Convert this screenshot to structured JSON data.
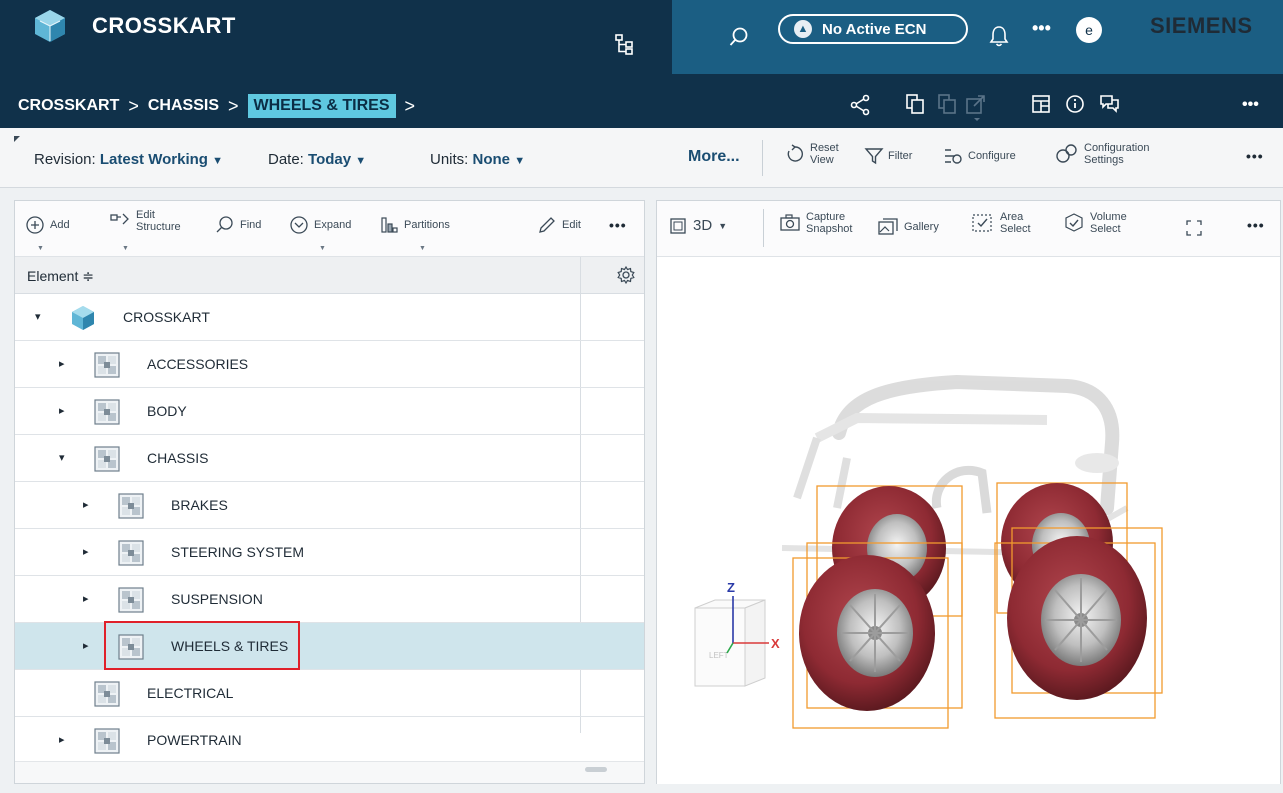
{
  "header": {
    "app_title": "CROSSKART",
    "ecn_label": "No Active ECN",
    "avatar_initial": "e",
    "brand": "SIEMENS",
    "more_glyph": "•••"
  },
  "breadcrumb": {
    "items": [
      "CROSSKART",
      "CHASSIS",
      "WHEELS & TIRES"
    ],
    "separator": ">"
  },
  "filter_bar": {
    "revision_label": "Revision:",
    "revision_value": "Latest Working",
    "date_label": "Date:",
    "date_value": "Today",
    "units_label": "Units:",
    "units_value": "None",
    "more_label": "More...",
    "reset_view_1": "Reset",
    "reset_view_2": "View",
    "filter_label": "Filter",
    "configure_label": "Configure",
    "config_settings_1": "Configuration",
    "config_settings_2": "Settings",
    "more_glyph": "•••"
  },
  "structure_toolbar": {
    "add": "Add",
    "edit_structure_1": "Edit",
    "edit_structure_2": "Structure",
    "find": "Find",
    "expand": "Expand",
    "partitions": "Partitions",
    "edit": "Edit",
    "more_glyph": "•••"
  },
  "structure_table": {
    "column_header": "Element ≑",
    "rows": [
      {
        "label": "CROSSKART",
        "twisty": "▾"
      },
      {
        "label": "ACCESSORIES",
        "twisty": "▸"
      },
      {
        "label": "BODY",
        "twisty": "▸"
      },
      {
        "label": "CHASSIS",
        "twisty": "▾"
      },
      {
        "label": "BRAKES",
        "twisty": "▸"
      },
      {
        "label": "STEERING SYSTEM",
        "twisty": "▸"
      },
      {
        "label": "SUSPENSION",
        "twisty": "▸"
      },
      {
        "label": "WHEELS & TIRES",
        "twisty": "▸",
        "selected": true
      },
      {
        "label": "ELECTRICAL",
        "twisty": ""
      },
      {
        "label": "POWERTRAIN",
        "twisty": "▸"
      }
    ]
  },
  "viewer_toolbar": {
    "mode": "3D",
    "capture_1": "Capture",
    "capture_2": "Snapshot",
    "gallery": "Gallery",
    "area_1": "Area",
    "area_2": "Select",
    "volume_1": "Volume",
    "volume_2": "Select",
    "more_glyph": "•••"
  },
  "viewer": {
    "axis_z": "Z",
    "axis_x": "X",
    "cube_face": "LEFT",
    "tire_color": "#8e2a33",
    "box_color": "#f29a2e"
  },
  "colors": {
    "header_dark": "#10314a",
    "header_strip": "#1b5e83",
    "breadcrumb_highlight": "#5fc8e0",
    "selection": "#cfe5ec",
    "highlight_border": "#e0202a"
  }
}
